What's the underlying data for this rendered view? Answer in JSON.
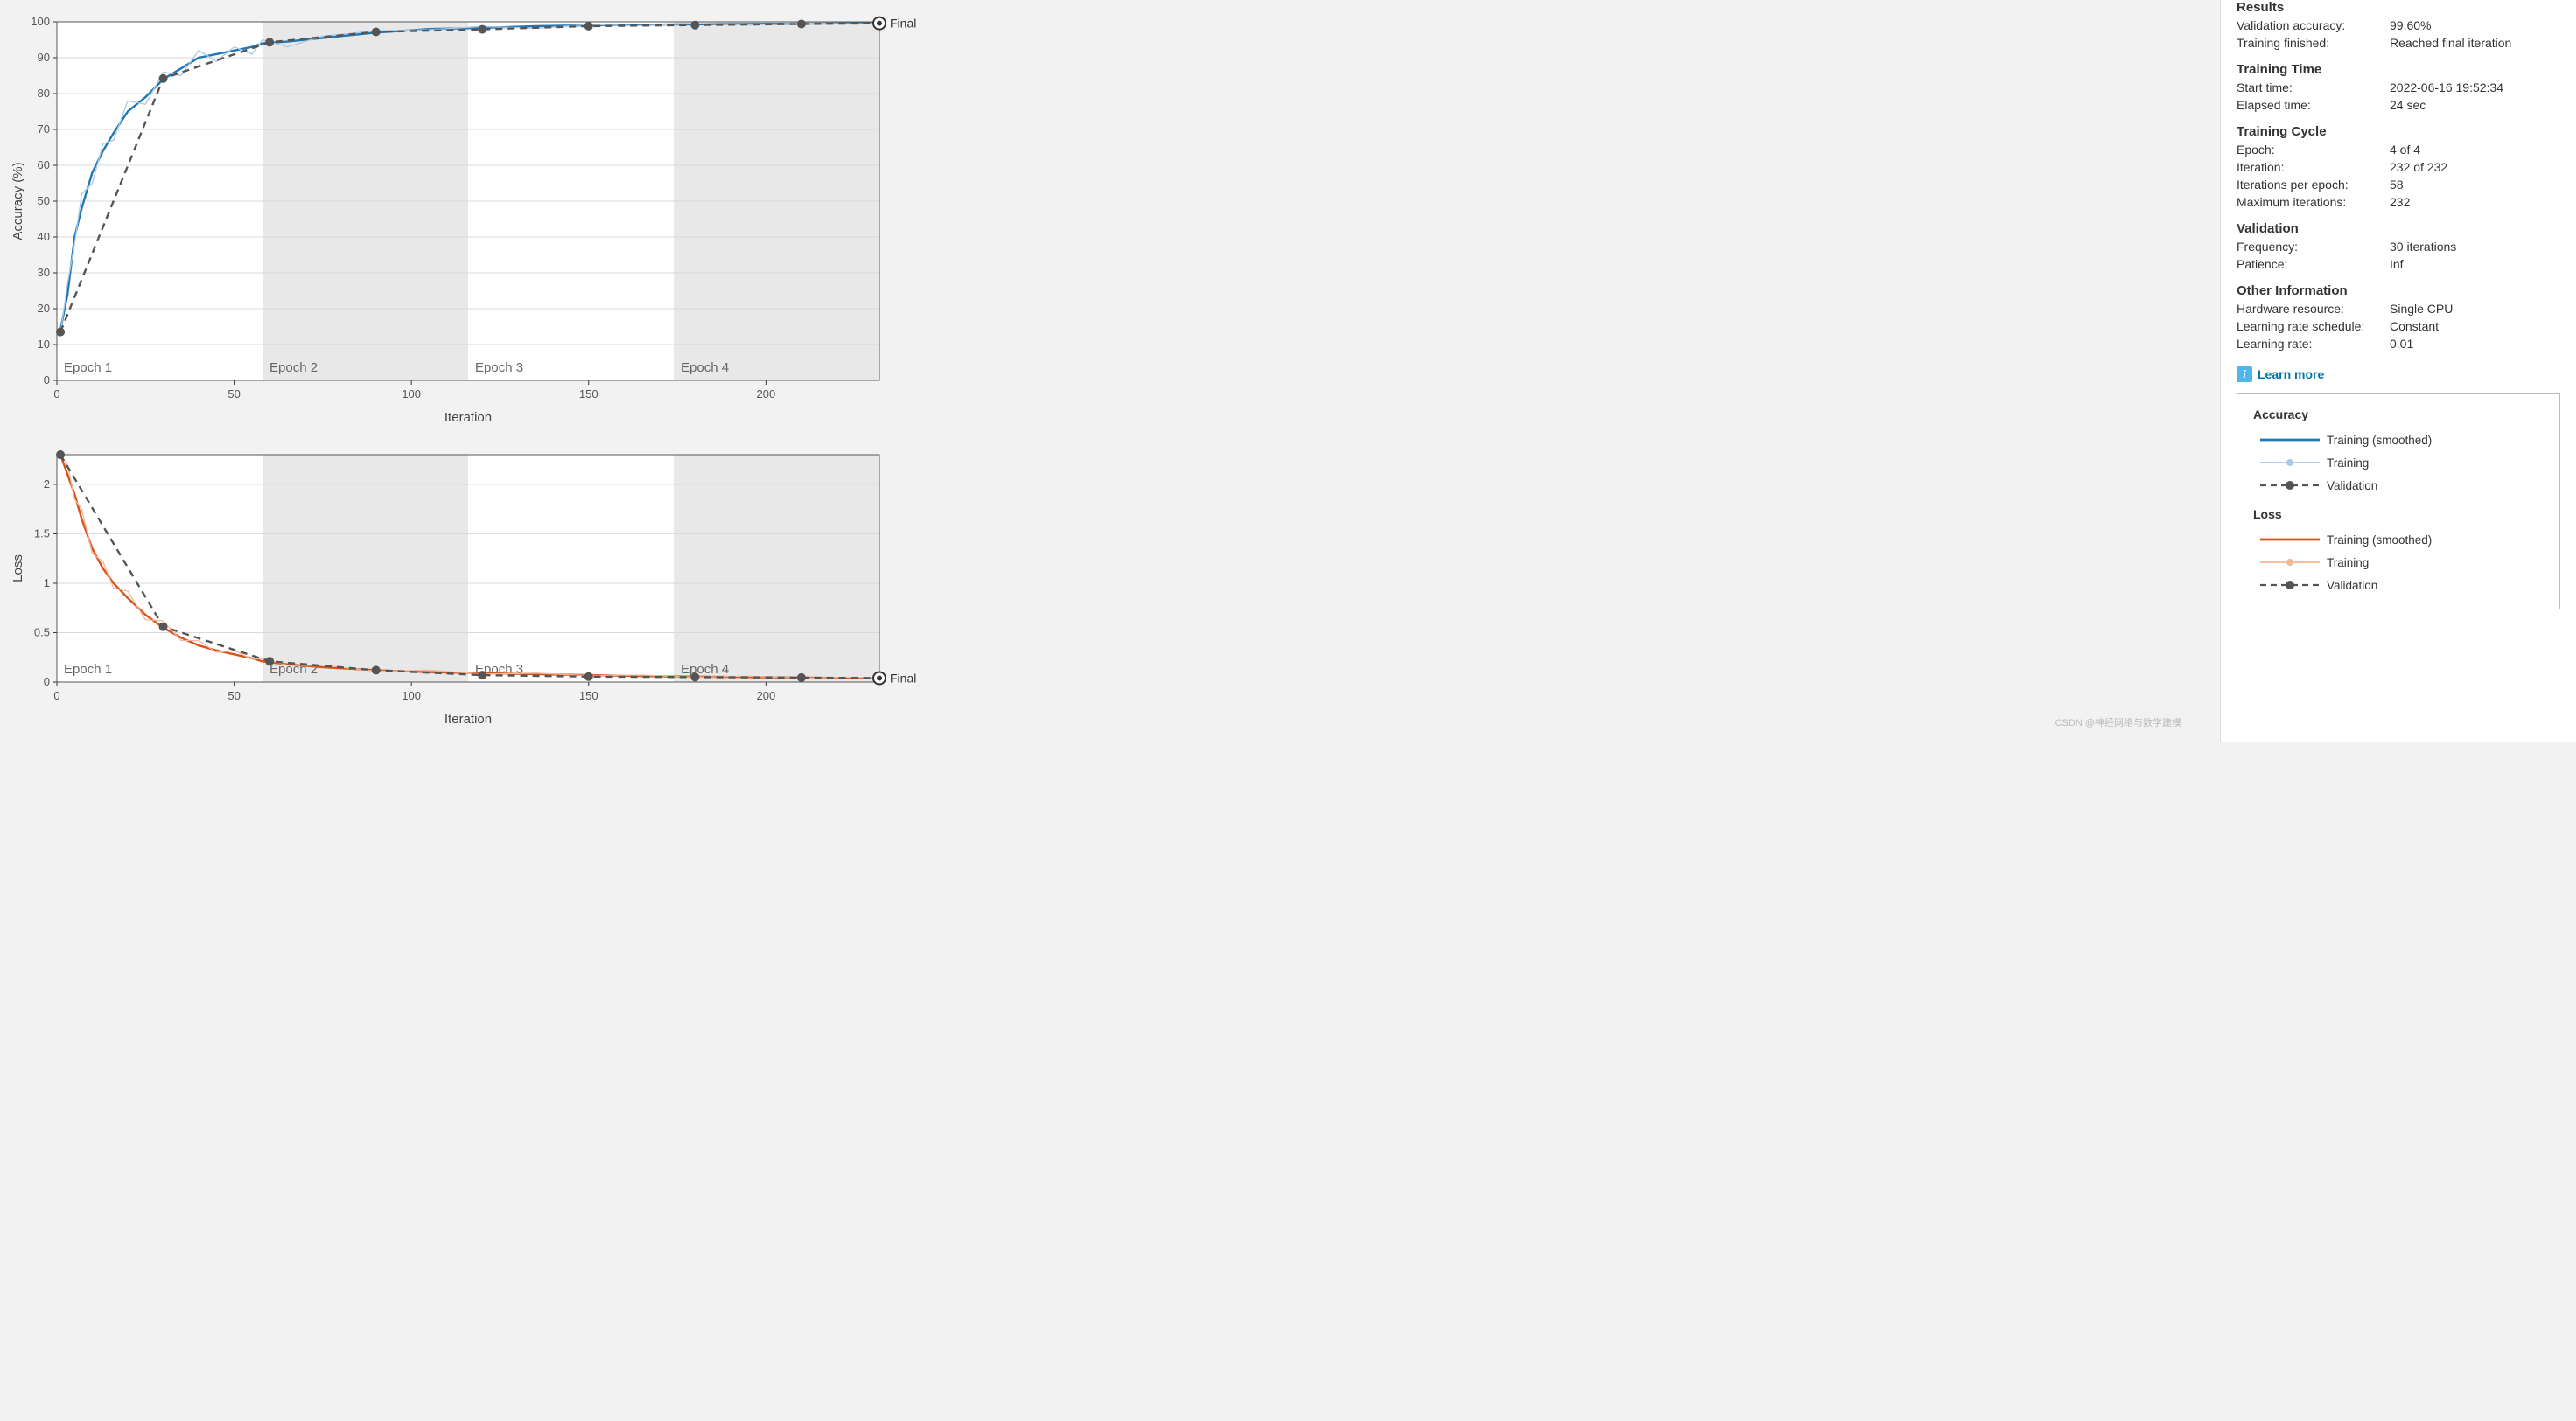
{
  "chart_data": [
    {
      "type": "line",
      "title": "",
      "xlabel": "Iteration",
      "ylabel": "Accuracy (%)",
      "xlim": [
        0,
        232
      ],
      "ylim": [
        0,
        100
      ],
      "xticks": [
        0,
        50,
        100,
        150,
        200
      ],
      "yticks": [
        0,
        10,
        20,
        30,
        40,
        50,
        60,
        70,
        80,
        90,
        100
      ],
      "epoch_boundaries": [
        0,
        58,
        116,
        174,
        232
      ],
      "epoch_labels": [
        "Epoch 1",
        "Epoch 2",
        "Epoch 3",
        "Epoch 4"
      ],
      "final_label": "Final",
      "series": [
        {
          "name": "Training (smoothed)",
          "color": "#1f77b4",
          "x": [
            1,
            3,
            5,
            7,
            10,
            13,
            16,
            20,
            25,
            30,
            35,
            40,
            45,
            50,
            55,
            58,
            65,
            75,
            90,
            105,
            120,
            135,
            150,
            165,
            180,
            195,
            210,
            225,
            232
          ],
          "y": [
            14,
            24,
            40,
            48,
            58,
            64,
            69,
            75,
            79,
            84,
            87,
            90,
            91,
            92,
            93,
            94,
            94.5,
            95.5,
            97,
            98,
            98.3,
            98.8,
            99.0,
            99.2,
            99.3,
            99.4,
            99.5,
            99.6,
            99.6
          ]
        },
        {
          "name": "Training",
          "color": "#a9c9e8",
          "x": [
            1,
            3,
            5,
            7,
            10,
            13,
            16,
            20,
            25,
            30,
            35,
            40,
            45,
            50,
            55,
            58,
            65,
            75,
            90,
            105,
            120,
            135,
            150,
            165,
            180,
            195,
            210,
            225,
            232
          ],
          "y": [
            13,
            27,
            38,
            52,
            55,
            66,
            67,
            78,
            77,
            86,
            85,
            92,
            89,
            93,
            91,
            95,
            93,
            96,
            97.5,
            97.8,
            98.7,
            98.2,
            99.2,
            98.9,
            99.5,
            99.1,
            99.7,
            99.4,
            99.6
          ]
        },
        {
          "name": "Validation",
          "color": "#555555",
          "dashed": true,
          "x": [
            1,
            30,
            60,
            90,
            120,
            150,
            180,
            210,
            232
          ],
          "y": [
            13.5,
            84.2,
            94.3,
            97.2,
            97.9,
            98.8,
            99.1,
            99.4,
            99.6
          ]
        }
      ]
    },
    {
      "type": "line",
      "title": "",
      "xlabel": "Iteration",
      "ylabel": "Loss",
      "xlim": [
        0,
        232
      ],
      "ylim": [
        0,
        2.3
      ],
      "xticks": [
        0,
        50,
        100,
        150,
        200
      ],
      "yticks": [
        0,
        0.5,
        1,
        1.5,
        2
      ],
      "epoch_boundaries": [
        0,
        58,
        116,
        174,
        232
      ],
      "epoch_labels": [
        "Epoch 1",
        "Epoch 2",
        "Epoch 3",
        "Epoch 4"
      ],
      "final_label": "Final",
      "series": [
        {
          "name": "Training (smoothed)",
          "color": "#d95319",
          "x": [
            1,
            3,
            5,
            7,
            10,
            13,
            16,
            20,
            25,
            30,
            35,
            40,
            45,
            50,
            55,
            58,
            65,
            75,
            90,
            105,
            120,
            135,
            150,
            165,
            180,
            195,
            210,
            225,
            232
          ],
          "y": [
            2.3,
            2.1,
            1.9,
            1.65,
            1.35,
            1.15,
            1.0,
            0.85,
            0.68,
            0.55,
            0.45,
            0.37,
            0.32,
            0.28,
            0.24,
            0.21,
            0.18,
            0.15,
            0.12,
            0.1,
            0.09,
            0.08,
            0.07,
            0.06,
            0.055,
            0.05,
            0.045,
            0.04,
            0.04
          ]
        },
        {
          "name": "Training",
          "color": "#f3b79a",
          "x": [
            1,
            3,
            5,
            7,
            10,
            13,
            16,
            20,
            25,
            30,
            35,
            40,
            45,
            50,
            55,
            58,
            65,
            75,
            90,
            105,
            120,
            135,
            150,
            165,
            180,
            195,
            210,
            225,
            232
          ],
          "y": [
            2.3,
            2.2,
            1.85,
            1.75,
            1.3,
            1.22,
            0.95,
            0.92,
            0.63,
            0.62,
            0.42,
            0.42,
            0.3,
            0.32,
            0.23,
            0.24,
            0.17,
            0.17,
            0.11,
            0.12,
            0.08,
            0.09,
            0.065,
            0.07,
            0.05,
            0.06,
            0.04,
            0.05,
            0.04
          ]
        },
        {
          "name": "Validation",
          "color": "#555555",
          "dashed": true,
          "x": [
            1,
            30,
            60,
            90,
            120,
            150,
            180,
            210,
            232
          ],
          "y": [
            2.3,
            0.56,
            0.21,
            0.12,
            0.07,
            0.055,
            0.05,
            0.045,
            0.04
          ]
        }
      ]
    }
  ],
  "side": {
    "results_title": "Results",
    "validation_accuracy_k": "Validation accuracy:",
    "validation_accuracy_v": "99.60%",
    "training_finished_k": "Training finished:",
    "training_finished_v": "Reached final iteration",
    "time_title": "Training Time",
    "start_time_k": "Start time:",
    "start_time_v": "2022-06-16 19:52:34",
    "elapsed_k": "Elapsed time:",
    "elapsed_v": "24 sec",
    "cycle_title": "Training Cycle",
    "epoch_k": "Epoch:",
    "epoch_v": "4 of 4",
    "iter_k": "Iteration:",
    "iter_v": "232 of 232",
    "ipe_k": "Iterations per epoch:",
    "ipe_v": "58",
    "maxiter_k": "Maximum iterations:",
    "maxiter_v": "232",
    "val_title": "Validation",
    "freq_k": "Frequency:",
    "freq_v": "30 iterations",
    "patience_k": "Patience:",
    "patience_v": "Inf",
    "other_title": "Other Information",
    "hw_k": "Hardware resource:",
    "hw_v": "Single CPU",
    "lrs_k": "Learning rate schedule:",
    "lrs_v": "Constant",
    "lr_k": "Learning rate:",
    "lr_v": "0.01",
    "learn_more": "Learn more"
  },
  "legend": {
    "acc_title": "Accuracy",
    "loss_title": "Loss",
    "train_smooth": "Training (smoothed)",
    "train": "Training",
    "validation": "Validation"
  },
  "watermark": "CSDN @神经网络与数学建模"
}
